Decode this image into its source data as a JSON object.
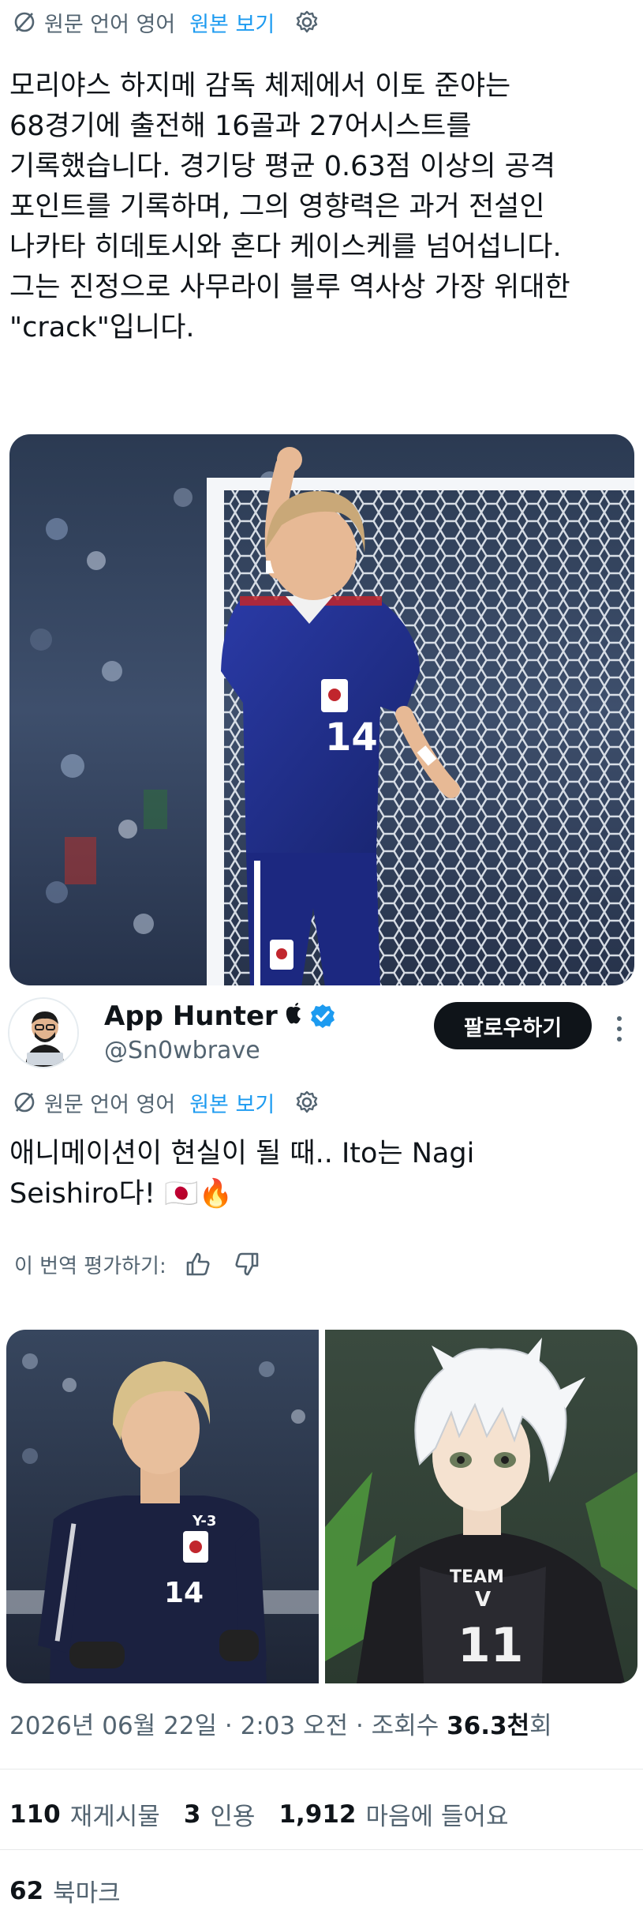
{
  "tweet1": {
    "translate_original": "원문 언어 영어",
    "translate_view": "원본 보기",
    "text": "모리야스 하지메 감독 체제에서 이토 준야는\n68경기에 출전해 16골과 27어시스트를\n기록했습니다. 경기당 평균 0.63점 이상의 공격\n포인트를 기록하며, 그의 영향력은 과거 전설인\n나카타 히데토시와 혼다 케이스케를 넘어섭니다.\n그는 진정으로 사무라이 블루 역사상 가장 위대한\n\"crack\"입니다.",
    "jersey_number": "14"
  },
  "author": {
    "name": "App Hunter",
    "handle": "@Sn0wbrave",
    "follow_label": "팔로우하기"
  },
  "tweet2": {
    "translate_original": "원문 언어 영어",
    "translate_view": "원본 보기",
    "text": "애니메이션이 현실이 될 때.. Ito는 Nagi\nSeishiro다! 🇯🇵🔥",
    "rate_label": "이 번역 평가하기:",
    "jersey_number": "14",
    "anime_team_text": "TEAM",
    "anime_team_letter": "V",
    "anime_number": "11"
  },
  "meta": {
    "timestamp": "2026년 06월 22일 · 2:03 오전 · 조회수 ",
    "views_value": "36.3천",
    "views_suffix": "회"
  },
  "stats": {
    "reposts_count": "110",
    "reposts_label": "재게시물",
    "quotes_count": "3",
    "quotes_label": "인용",
    "likes_count": "1,912",
    "likes_label": "마음에 들어요",
    "bookmarks_count": "62",
    "bookmarks_label": "북마크"
  },
  "colors": {
    "link": "#1d9bf0",
    "muted": "#536471",
    "text": "#0f1419",
    "japan_blue": "#1f2f8f"
  }
}
